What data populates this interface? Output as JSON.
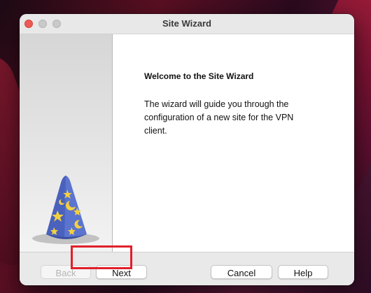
{
  "window": {
    "title": "Site Wizard"
  },
  "main": {
    "heading": "Welcome to the Site Wizard",
    "body": "The wizard will guide you through the configuration of a new site for the VPN client."
  },
  "buttons": {
    "back": "Back",
    "next": "Next",
    "cancel": "Cancel",
    "help": "Help"
  },
  "colors": {
    "highlight": "#e0202a",
    "close": "#ee5a55"
  },
  "icons": {
    "wizard_hat": "wizard-hat-icon"
  }
}
